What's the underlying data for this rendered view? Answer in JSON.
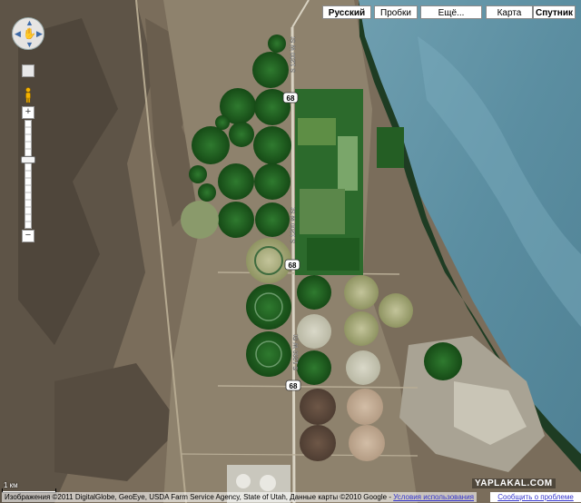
{
  "controls": {
    "language": "Русский",
    "traffic": "Пробки",
    "more": "Ещё...",
    "map": "Карта",
    "satellite": "Спутник"
  },
  "pan_control": {
    "icon": "hand-icon"
  },
  "zoom": {
    "plus": "+",
    "minus": "−"
  },
  "road_labels": {
    "route_68_a": "68",
    "route_68_b": "68",
    "route_68_c": "68",
    "street_1": "S 1200 W St",
    "street_2": "S 1200 W St",
    "street_3": "S 1200 W St"
  },
  "scale": {
    "label": "1 км"
  },
  "attribution": {
    "text": "Изображения ©2011 DigitalGlobe, GeoEye, USDA Farm Service Agency, State of Utah, Данные карты ©2010 Google - ",
    "link": "Условия использования"
  },
  "report": "Сообщить о проблеме",
  "watermark": "YAPLAKAL.COM",
  "colors": {
    "lake": "#5f8fa0",
    "desert": "#7b6f5c",
    "field_green": "#1f5a1f"
  }
}
